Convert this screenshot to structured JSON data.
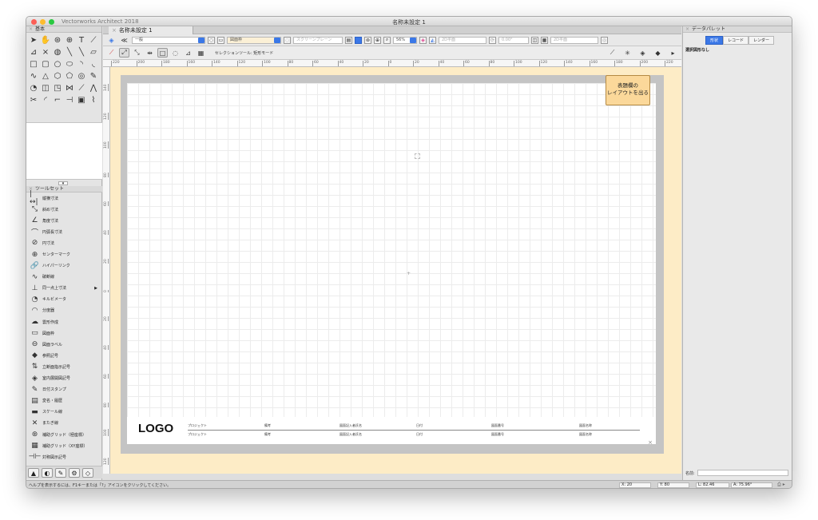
{
  "window": {
    "app_title": "Vectorworks Architect 2018",
    "doc_title": "名称未設定 1"
  },
  "left_palette": {
    "basic_title": "基本",
    "toolset_title": "ツールセット",
    "tools": [
      {
        "label": "縦横寸法",
        "icon": "|↔|"
      },
      {
        "label": "斜め寸法",
        "icon": "⤡"
      },
      {
        "label": "角度寸法",
        "icon": "∠"
      },
      {
        "label": "円弧長寸法",
        "icon": "⌒"
      },
      {
        "label": "円寸法",
        "icon": "⊘"
      },
      {
        "label": "センターマーク",
        "icon": "⊕"
      },
      {
        "label": "ハイパーリンク",
        "icon": "🔗"
      },
      {
        "label": "破断線",
        "icon": "∿"
      },
      {
        "label": "同一点上寸法",
        "icon": "⊥",
        "has_submenu": true
      },
      {
        "label": "キルビメータ",
        "icon": "◔"
      },
      {
        "label": "分度器",
        "icon": "◠"
      },
      {
        "label": "雲形作成",
        "icon": "☁"
      },
      {
        "label": "図面枠",
        "icon": "▭"
      },
      {
        "label": "図面ラベル",
        "icon": "⊖"
      },
      {
        "label": "参照記号",
        "icon": "◆"
      },
      {
        "label": "立断面指示記号",
        "icon": "⇅"
      },
      {
        "label": "室内展開図記号",
        "icon": "◈"
      },
      {
        "label": "日付スタンプ",
        "icon": "✎"
      },
      {
        "label": "変名・履歴",
        "icon": "▤"
      },
      {
        "label": "スケール線",
        "icon": "▬"
      },
      {
        "label": "またぎ線",
        "icon": "✕"
      },
      {
        "label": "補助グリッド（極座標）",
        "icon": "⊛"
      },
      {
        "label": "補助グリッド（XY座標）",
        "icon": "▦"
      },
      {
        "label": "対称図示記号",
        "icon": "⊣⊢"
      }
    ]
  },
  "tab": {
    "label": "名称未設定 1"
  },
  "view_bar": {
    "class_value": "一般",
    "layer_value": "図面枠",
    "sheet_value": "スクリーンプレーン",
    "zoom_value": "56%",
    "plane_value": "2D平面",
    "rotation_value": "0.00°",
    "plane2_value": "2D平面"
  },
  "tool_bar": {
    "mode_label": "セレクションツール: 矩形モード"
  },
  "rulers": {
    "h_ticks": [
      "220",
      "200",
      "180",
      "160",
      "140",
      "120",
      "100",
      "80",
      "60",
      "40",
      "20",
      "0",
      "20",
      "40",
      "60",
      "80",
      "100",
      "120",
      "140",
      "160",
      "180",
      "200",
      "220"
    ],
    "v_ticks": [
      "140",
      "120",
      "100",
      "80",
      "60",
      "40",
      "20",
      "0",
      "20",
      "40",
      "60",
      "80",
      "100",
      "120",
      "140"
    ]
  },
  "canvas": {
    "layout_button": [
      "表題欄の",
      "レイアウトを出る"
    ],
    "logo": "LOGO",
    "title_block": {
      "row1": [
        "プロジェクト",
        "備考",
        "図面記入者氏名",
        "日付",
        "図面番号",
        "図面名称"
      ],
      "row2": [
        "プロジェクト",
        "備考",
        "図面記入者氏名",
        "日付",
        "図面番号",
        "図面名称"
      ]
    }
  },
  "status_bar": {
    "help_text": "ヘルプを表示するには、F1キーまたは「?」アイコンをクリックしてください。",
    "x_value": "X: 20",
    "y_value": "Y: 80",
    "l_value": "L: 82.46",
    "a_value": "A: 75.96°"
  },
  "data_palette": {
    "title": "データパレット",
    "tabs": [
      "形状",
      "レコード",
      "レンダー"
    ],
    "no_selection": "選択図形なし",
    "name_label": "名前:"
  },
  "colors": {
    "accent": "#3b78e7",
    "canvas_bg": "#fdecc6",
    "layout_button": "#fbd89a"
  }
}
